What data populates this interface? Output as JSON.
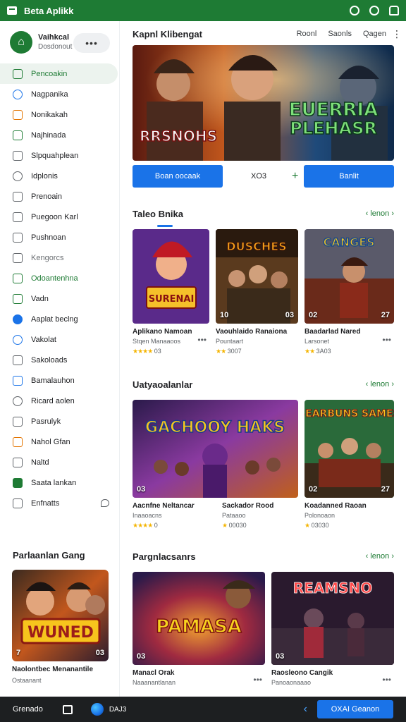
{
  "window": {
    "title": "Beta Aplikk"
  },
  "profile": {
    "name": "Vaihkcal",
    "sub": "Dosdonout",
    "more": "•••"
  },
  "nav": [
    {
      "label": "Pencoakin",
      "icon": "home-icon"
    },
    {
      "label": "Nagpanika",
      "icon": "compass-icon"
    },
    {
      "label": "Nonikakah",
      "icon": "grid-icon"
    },
    {
      "label": "Najhinada",
      "icon": "game-icon"
    },
    {
      "label": "Slpquahplean",
      "icon": "list-icon"
    },
    {
      "label": "Idplonis",
      "icon": "chat-icon"
    },
    {
      "label": "Prenoain",
      "icon": "doc-icon"
    },
    {
      "label": "Puegoon Karl",
      "icon": "book-icon"
    },
    {
      "label": "Pushnoan",
      "icon": "card-icon"
    },
    {
      "label": "Kengorcs",
      "icon": "tag-icon"
    },
    {
      "label": "Odoantenhna",
      "icon": "shop-icon"
    },
    {
      "label": "Vadn",
      "icon": "chart-icon"
    },
    {
      "label": "Aaplat beclng",
      "icon": "globe-icon"
    },
    {
      "label": "Vakolat",
      "icon": "link-icon"
    },
    {
      "label": "Sakoloads",
      "icon": "download-icon"
    },
    {
      "label": "Bamalauhon",
      "icon": "user-icon"
    },
    {
      "label": "Ricard aolen",
      "icon": "settings-icon"
    },
    {
      "label": "Pasrulyk",
      "icon": "wallet-icon"
    },
    {
      "label": "Nahol Gfan",
      "icon": "gift-icon"
    },
    {
      "label": "Naltd",
      "icon": "note-icon"
    },
    {
      "label": "Saata lankan",
      "icon": "gamepad-icon"
    },
    {
      "label": "Enfnatts",
      "icon": "help-icon"
    }
  ],
  "side_section": {
    "title": "Parlaanlan Gang",
    "card_title": "Naolontbec Menanantile",
    "card_sub": "Ostaanant",
    "card_logo": "WUNED",
    "badge_l": "7",
    "badge_r": "03"
  },
  "main": {
    "title": "Kapnl Klibengat",
    "links": [
      "Roonl",
      "Saonls",
      "Qagen"
    ],
    "kebab": "⋮",
    "hero_logo_1": "EUERRIA",
    "hero_logo_2": "PLEHASR",
    "hero_logo_3": "RRSNOHS",
    "btn_left": "Boan oocaak",
    "btn_mid": "XO3",
    "btn_plus": "+",
    "btn_right": "Banlit"
  },
  "sections": [
    {
      "name": "Taleo Bnika",
      "more": "‹ lenon ›",
      "cards": [
        {
          "title": "Aplikano Namoan",
          "sub": "Stqen Manaaoos",
          "rating": "★★★★",
          "rv": "03",
          "logo": "SURENAI",
          "bl": "",
          "br": ""
        },
        {
          "title": "Vaouhlaido Ranaiona",
          "sub": "Pountaart",
          "rating": "★★",
          "rv": "3007",
          "logo": "DUSCHES",
          "bl": "10",
          "br": "03"
        },
        {
          "title": "Baadarlad Nared",
          "sub": "Larsonet",
          "rating": "★★",
          "rv": "3A03",
          "logo": "CANGES",
          "bl": "02",
          "br": "27"
        }
      ]
    },
    {
      "name": "Uatyaoalanlar",
      "more": "‹ lenon ›",
      "cards": [
        {
          "title": "Aacnfne Neltancar",
          "sub": "Inaaoacns",
          "rating": "★★★★",
          "rv": "0",
          "logo": "GACHOOY HAKS",
          "bl": "03",
          "br": ""
        },
        {
          "title": "Sackador Rood",
          "sub": "Pataaoo",
          "rating": "★",
          "rv": "00030",
          "logo": "",
          "bl": "",
          "br": ""
        },
        {
          "title": "Koadanned Raoan",
          "sub": "Polonoaon",
          "rating": "★",
          "rv": "03030",
          "logo": "BEARBUNS SAMES",
          "bl": "02",
          "br": "27"
        }
      ]
    },
    {
      "name": "Pargnlacsanrs",
      "more": "‹ lenon ›",
      "cards": [
        {
          "title": "Manacl Orak",
          "sub": "Naaanantlanan",
          "rating": "★",
          "rv": "",
          "logo": "PAMASA",
          "bl": "03",
          "br": ""
        },
        {
          "title": "Raosleono Cangik",
          "sub": "Panoaonaaao",
          "rating": "★",
          "rv": "",
          "logo": "REAMSNO",
          "bl": "03",
          "br": ""
        }
      ]
    }
  ],
  "bottombar": {
    "left": "Grenado",
    "count": "DAJ3",
    "cta": "OXAI Geanon"
  },
  "colors": {
    "accent": "#1e7b34",
    "button": "#1a73e8",
    "star": "#f4b400"
  }
}
